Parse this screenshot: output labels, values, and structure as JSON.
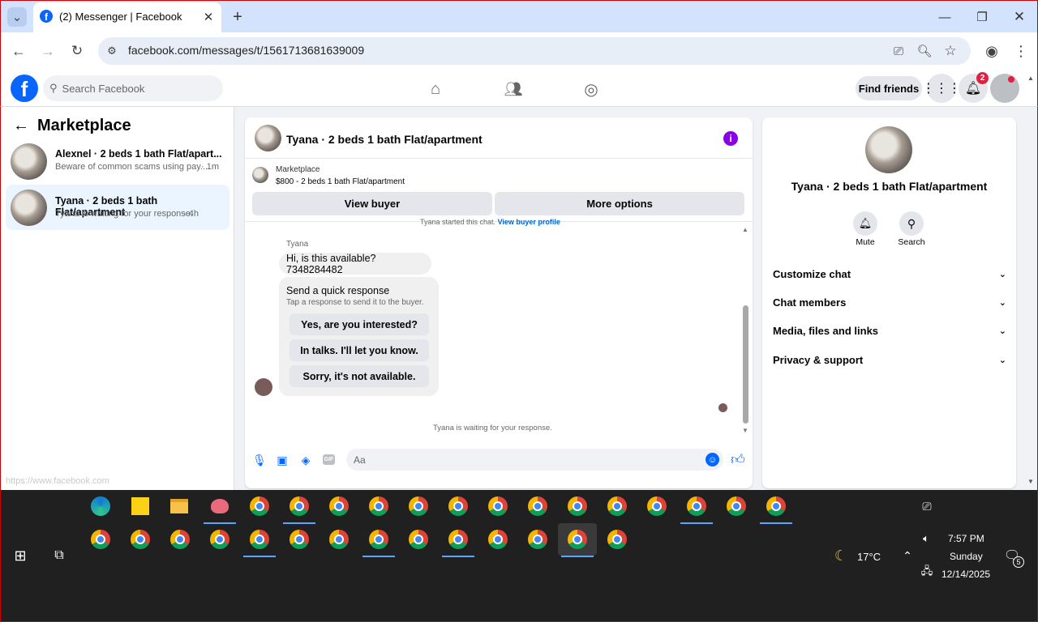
{
  "browser": {
    "tab_title": "(2) Messenger | Facebook",
    "url": "facebook.com/messages/t/1561713681639009",
    "status_url": "https://www.facebook.com"
  },
  "fb": {
    "search_placeholder": "Search Facebook",
    "find_friends": "Find friends",
    "notif_count": "2"
  },
  "sidebar": {
    "title": "Marketplace",
    "conversations": [
      {
        "name": "Alexnel · 2 beds 1 bath Flat/apart...",
        "preview": "Beware of common scams using pay...",
        "time": "· 1m"
      },
      {
        "name": "Tyana · 2 beds 1 bath Flat/apartment",
        "preview": "Tyana is waiting for your response.",
        "time": "· 4h"
      }
    ]
  },
  "chat": {
    "title": "Tyana · 2 beds 1 bath Flat/apartment",
    "listing_source": "Marketplace",
    "listing_desc": "$800 - 2 beds 1 bath Flat/apartment",
    "view_buyer": "View buyer",
    "more_options": "More options",
    "started_text": "Tyana started this chat.",
    "started_link": "View buyer profile",
    "sender": "Tyana",
    "message": "Hi, is this available? 7348284482",
    "quick_title": "Send a quick response",
    "quick_sub": "Tap a response to send it to the buyer.",
    "quick_replies": [
      "Yes, are you interested?",
      "In talks. I'll let you know.",
      "Sorry, it's not available."
    ],
    "waiting": "Tyana is waiting for your response.",
    "composer_placeholder": "Aa"
  },
  "info": {
    "title": "Tyana · 2 beds 1 bath Flat/apartment",
    "mute": "Mute",
    "search": "Search",
    "sections": [
      "Customize chat",
      "Chat members",
      "Media, files and links",
      "Privacy & support"
    ]
  },
  "taskbar": {
    "weather": "17°C",
    "time": "7:57 PM",
    "day": "Sunday",
    "date": "12/14/2025",
    "notif_count": "5"
  }
}
